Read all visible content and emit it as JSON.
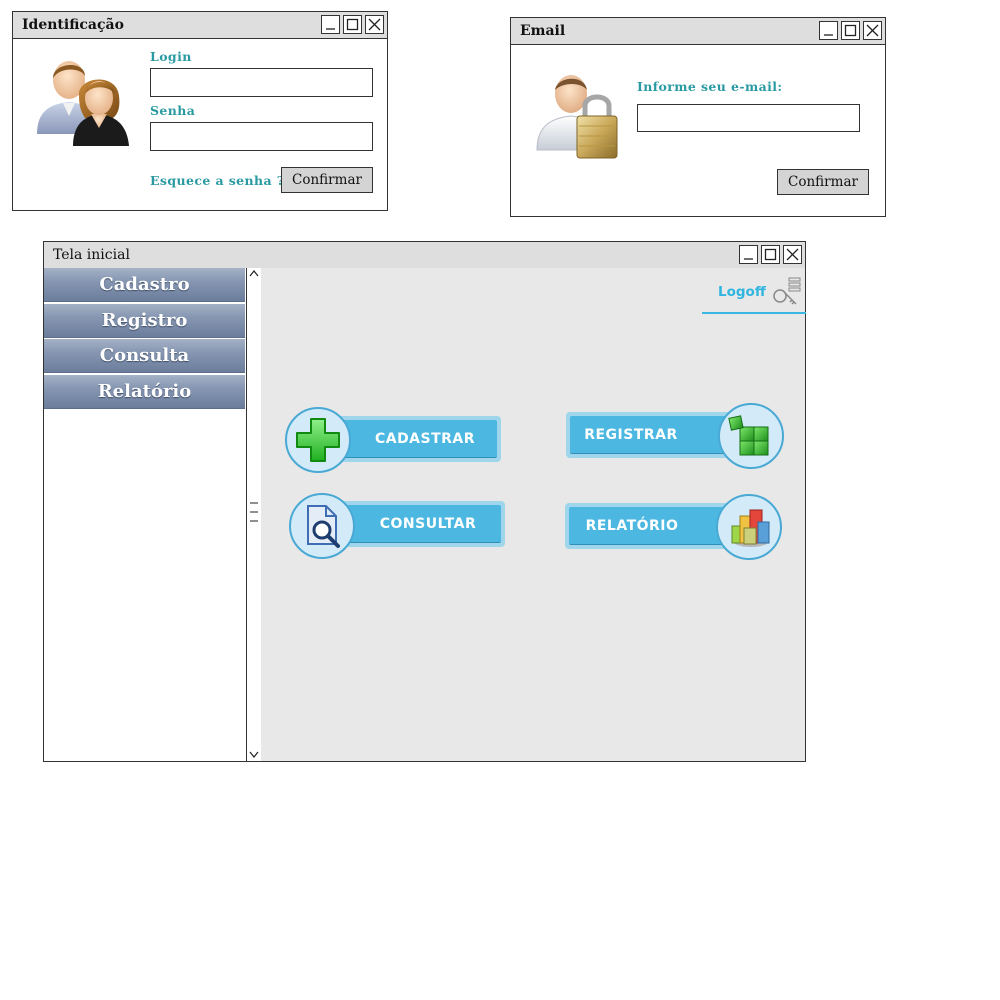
{
  "login_window": {
    "title": "Identificação",
    "login_label": "Login",
    "login_value": "",
    "password_label": "Senha",
    "password_value": "",
    "forgot_label": "Esquece a senha ?",
    "confirm_label": "Confirmar",
    "icon": "users-icon"
  },
  "email_window": {
    "title": "Email",
    "email_label": "Informe seu e-mail:",
    "email_value": "",
    "confirm_label": "Confirmar",
    "icon": "user-lock-icon"
  },
  "main_window": {
    "title": "Tela inicial",
    "menu": [
      {
        "label": "Cadastro"
      },
      {
        "label": "Registro"
      },
      {
        "label": "Consulta"
      },
      {
        "label": "Relatório"
      }
    ],
    "logoff_label": "Logoff",
    "actions": [
      {
        "label": "CADASTRAR",
        "icon": "plus-icon"
      },
      {
        "label": "REGISTRAR",
        "icon": "cubes-icon"
      },
      {
        "label": "CONSULTAR",
        "icon": "document-search-icon"
      },
      {
        "label": "RELATÓRIO",
        "icon": "chart-3d-icon"
      }
    ]
  },
  "colors": {
    "accent_teal": "#2a9aa2",
    "logoff_blue": "#2fb5e0",
    "pill_blue": "#4cb8e2",
    "menu_gradient": "#8797b2",
    "content_bg": "#e8e8e8"
  }
}
